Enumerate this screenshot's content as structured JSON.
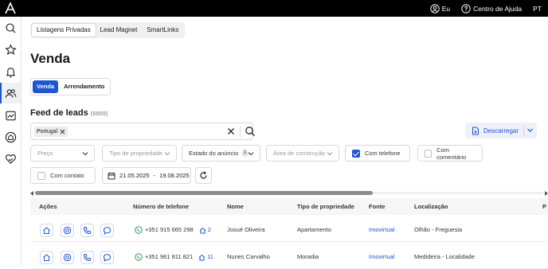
{
  "topbar": {
    "user_label": "Eu",
    "help_label": "Centro de Ajuda",
    "lang": "PT"
  },
  "sidebar": {
    "items": [
      "search-icon",
      "star-icon",
      "bell-icon",
      "users-icon",
      "chart-icon",
      "home-signal-icon",
      "heart-handshake-icon"
    ]
  },
  "tabs": [
    "Listagens Privadas",
    "Lead Magnet",
    "SmartLinks"
  ],
  "page_title": "Venda",
  "segment": [
    "Venda",
    "Arrendamento"
  ],
  "feed": {
    "title": "Feed de leads",
    "count": "(6859)"
  },
  "search": {
    "chip": "Portugal"
  },
  "download_label": "Descarregar",
  "filters": {
    "preco": "Preço",
    "tipo": "Tipo de propriedade",
    "estado": "Estado do anúncio",
    "estado_badge": "1",
    "area": "Área de construção",
    "com_telefone": "Com telefone",
    "com_comentario": "Com comentário",
    "com_contato": "Com contato",
    "date_from": "21.05.2025",
    "date_sep": "-",
    "date_to": "19.08.2025"
  },
  "table": {
    "headers": [
      "Ações",
      "Número de telefone",
      "Nome",
      "Tipo de propriedade",
      "Fonte",
      "Localização",
      "P"
    ],
    "rows": [
      {
        "phone": "+351 915 665 298",
        "count": "2",
        "name": "Josué Oliveira",
        "type": "Apartamento",
        "source": "Imovirtual",
        "location": "Olhão - Freguesia"
      },
      {
        "phone": "+351 961 811 821",
        "count": "11",
        "name": "Nunes Carvalho",
        "type": "Moradia",
        "source": "Imovirtual",
        "location": "Medideira - Localidade"
      }
    ]
  },
  "colors": {
    "accent": "#1e55d0",
    "topbar": "#000000"
  }
}
